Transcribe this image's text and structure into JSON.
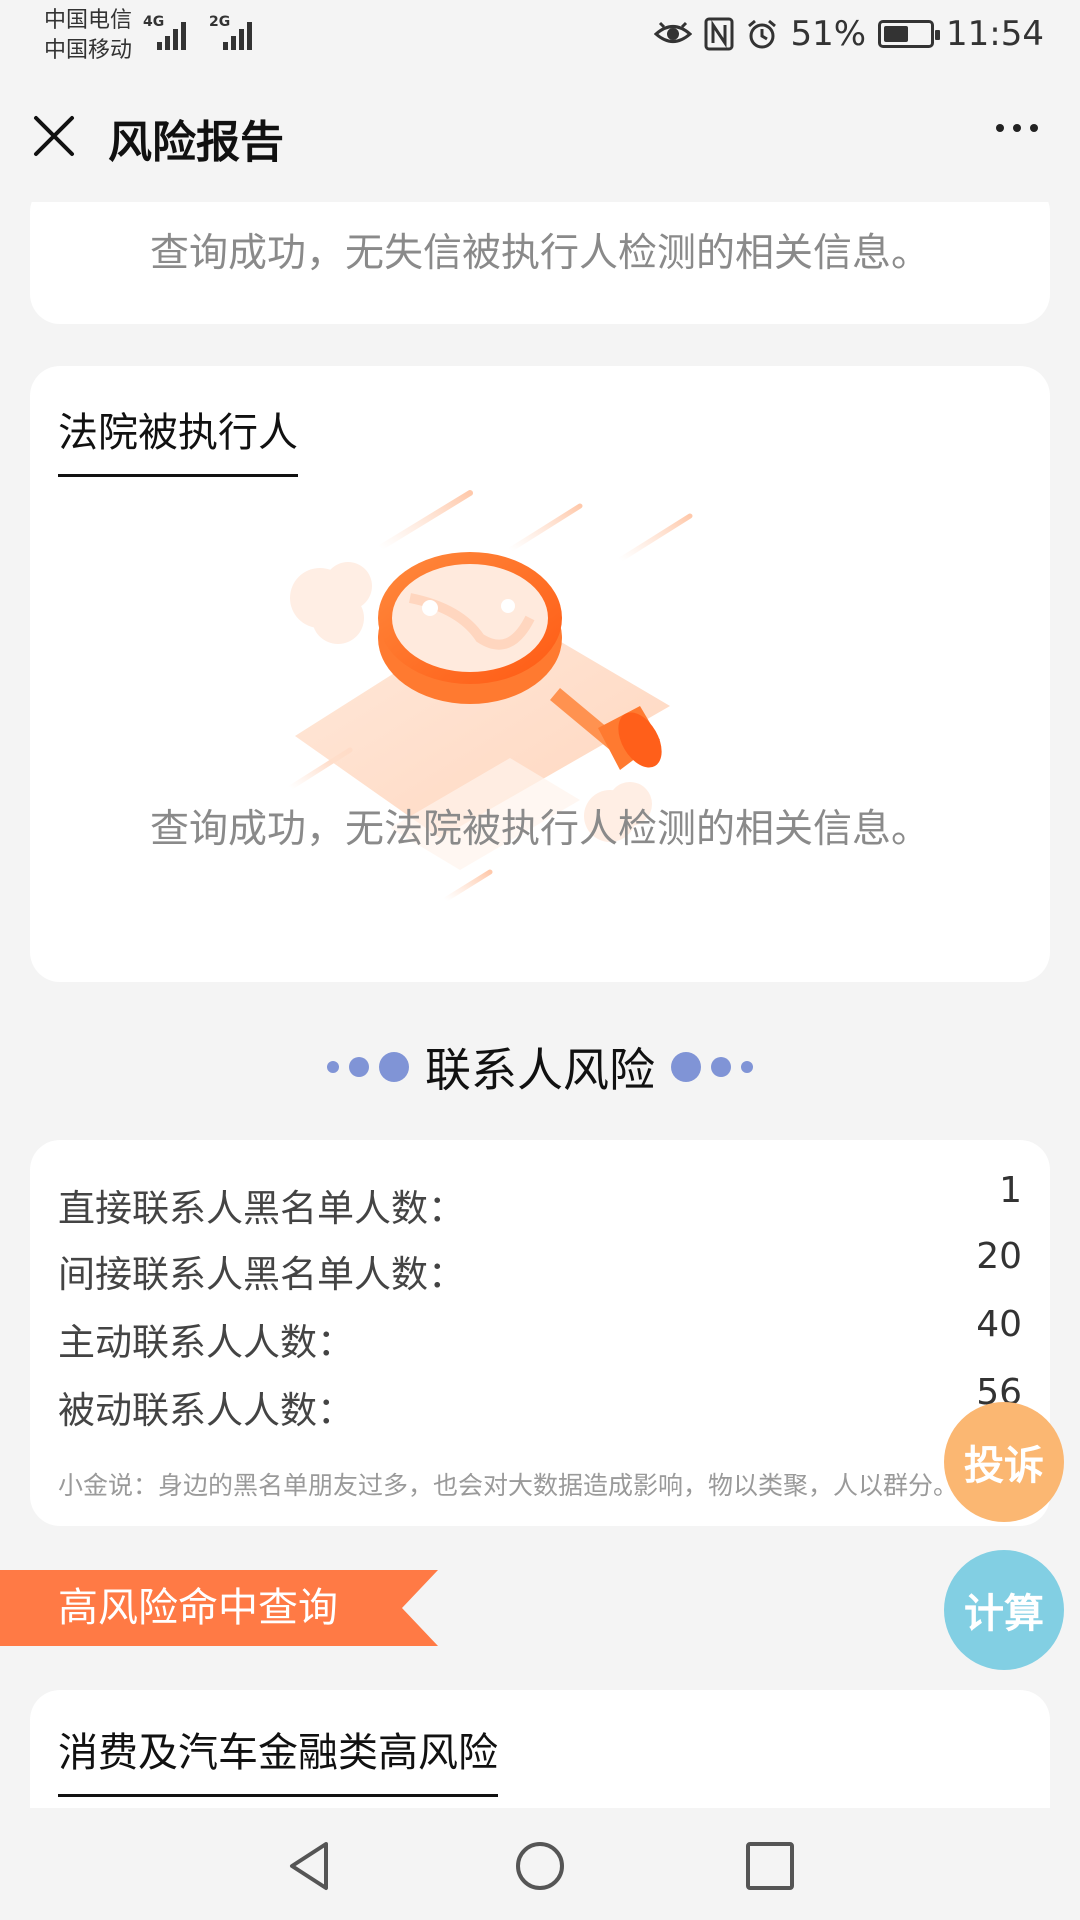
{
  "status_bar": {
    "carrier_1": "中国电信",
    "carrier_2": "中国移动",
    "network_1": "4G",
    "network_2": "2G",
    "battery": "51%",
    "time": "11:54",
    "icons": [
      "eye-icon",
      "nfc-icon",
      "alarm-icon",
      "battery-icon"
    ]
  },
  "header": {
    "title": "风险报告",
    "close_icon": "close-icon",
    "more_icon": "more-icon"
  },
  "cards": {
    "dishonest": {
      "message": "查询成功，无失信被执行人检测的相关信息。"
    },
    "court": {
      "title": "法院被执行人",
      "illustration": "magnifier-search-illustration",
      "message": "查询成功，无法院被执行人检测的相关信息。"
    }
  },
  "contact_risk": {
    "heading": "联系人风险",
    "rows": [
      {
        "label": "直接联系人黑名单人数：",
        "value": "1"
      },
      {
        "label": "间接联系人黑名单人数：",
        "value": "20"
      },
      {
        "label": "主动联系人人数：",
        "value": "40"
      },
      {
        "label": "被动联系人人数：",
        "value": "56"
      }
    ],
    "tip": "小金说：身边的黑名单朋友过多，也会对大数据造成影响，物以类聚，人以群分。"
  },
  "high_risk": {
    "banner": "高风险命中查询",
    "card_title": "消费及汽车金融类高风险"
  },
  "fabs": {
    "complaint": "投诉",
    "calculate": "计算"
  },
  "colors": {
    "accent_orange": "#ff7a45",
    "dot_blue": "#8094d6",
    "fab_orange": "#fbb772",
    "fab_blue": "#82cfe3"
  }
}
